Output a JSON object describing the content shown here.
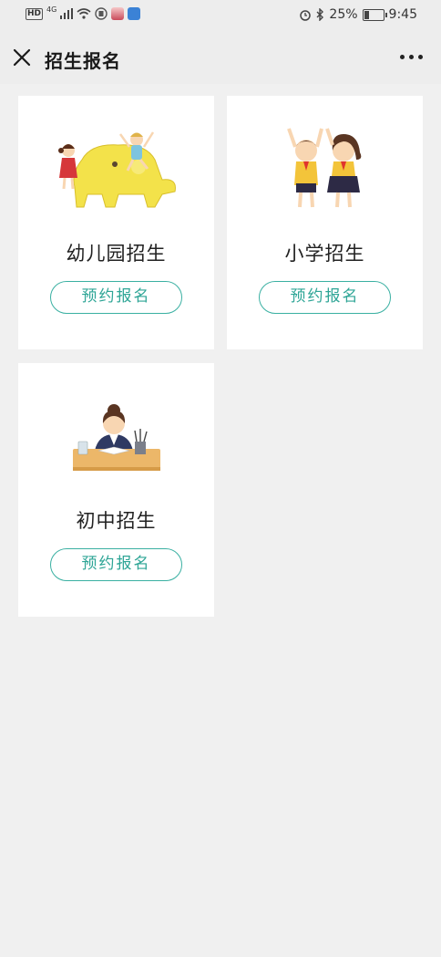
{
  "status_bar": {
    "left_badges": [
      "HD",
      "4G"
    ],
    "battery": "25%",
    "battery_level": 0.25,
    "time": "9:45",
    "icons": [
      "signal-icon",
      "wifi-icon",
      "alarm-icon",
      "bluetooth-icon",
      "battery-icon"
    ]
  },
  "nav": {
    "title": "招生报名",
    "close_icon": "close-icon",
    "more_icon": "more-icon"
  },
  "cards": [
    {
      "title": "幼儿园招生",
      "button": "预约报名",
      "illustration": "kindergarten-illustration"
    },
    {
      "title": "小学招生",
      "button": "预约报名",
      "illustration": "primary-school-illustration"
    },
    {
      "title": "初中招生",
      "button": "预约报名",
      "illustration": "junior-high-illustration"
    }
  ],
  "colors": {
    "accent": "#3ab0a2",
    "background": "#f0f0f0",
    "card": "#ffffff"
  }
}
